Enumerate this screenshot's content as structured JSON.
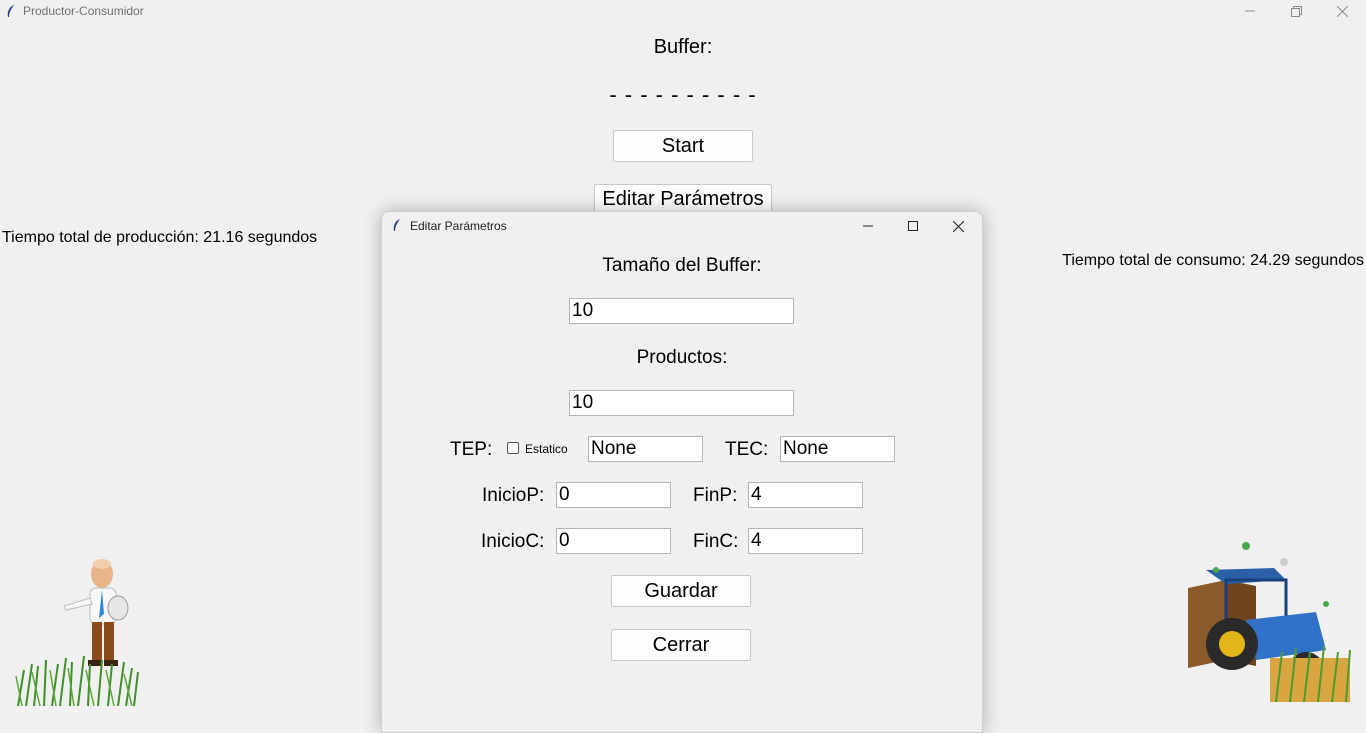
{
  "window": {
    "title": "Productor-Consumidor"
  },
  "main": {
    "buffer_label": "Buffer:",
    "buffer_content": "- - - - - - - - - -",
    "start_button": "Start",
    "edit_params_button": "Editar Parámetros",
    "production_time": "Tiempo total de producción: 21.16 segundos",
    "consumption_time": "Tiempo total de consumo: 24.29 segundos"
  },
  "dialog": {
    "title": "Editar Parámetros",
    "buffer_size_label": "Tamaño del Buffer:",
    "buffer_size_value": "10",
    "products_label": "Productos:",
    "products_value": "10",
    "tep_label": "TEP:",
    "static_checkbox_label": "Estatico",
    "static_checked": false,
    "tep_value": "None",
    "tec_label": "TEC:",
    "tec_value": "None",
    "inicio_p_label": "InicioP:",
    "inicio_p_value": "0",
    "fin_p_label": "FinP:",
    "fin_p_value": "4",
    "inicio_c_label": "InicioC:",
    "inicio_c_value": "0",
    "fin_c_label": "FinC:",
    "fin_c_value": "4",
    "save_button": "Guardar",
    "close_button": "Cerrar"
  },
  "icons": {
    "app": "feather-icon",
    "minimize": "minimize-icon",
    "maximize": "maximize-icon",
    "restore": "restore-icon",
    "close": "close-icon"
  },
  "images": {
    "producer": "producer-farmer-image",
    "consumer": "consumer-tractor-image"
  }
}
